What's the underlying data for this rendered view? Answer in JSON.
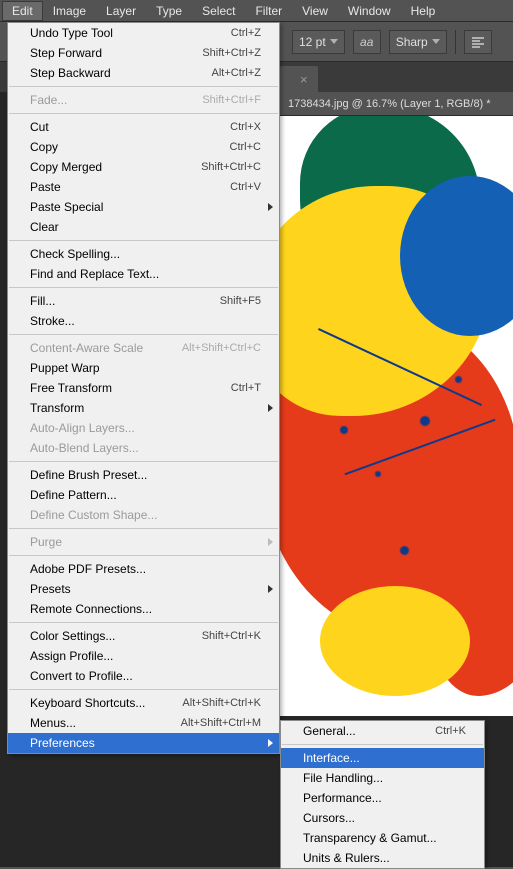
{
  "menubar": {
    "items": [
      "Edit",
      "Image",
      "Layer",
      "Type",
      "Select",
      "Filter",
      "View",
      "Window",
      "Help"
    ],
    "active": 0
  },
  "options": {
    "fontsize": "12 pt",
    "antialias_label": "aa",
    "antialias_mode": "Sharp"
  },
  "tab": {
    "close": "×"
  },
  "document": {
    "title_fragment": "1738434.jpg @ 16.7% (Layer 1, RGB/8) *"
  },
  "edit_menu": [
    {
      "label": "Undo Type Tool",
      "shortcut": "Ctrl+Z"
    },
    {
      "label": "Step Forward",
      "shortcut": "Shift+Ctrl+Z"
    },
    {
      "label": "Step Backward",
      "shortcut": "Alt+Ctrl+Z"
    },
    {
      "sep": true
    },
    {
      "label": "Fade...",
      "shortcut": "Shift+Ctrl+F",
      "disabled": true
    },
    {
      "sep": true
    },
    {
      "label": "Cut",
      "shortcut": "Ctrl+X"
    },
    {
      "label": "Copy",
      "shortcut": "Ctrl+C"
    },
    {
      "label": "Copy Merged",
      "shortcut": "Shift+Ctrl+C"
    },
    {
      "label": "Paste",
      "shortcut": "Ctrl+V"
    },
    {
      "label": "Paste Special",
      "submenu": true
    },
    {
      "label": "Clear"
    },
    {
      "sep": true
    },
    {
      "label": "Check Spelling..."
    },
    {
      "label": "Find and Replace Text..."
    },
    {
      "sep": true
    },
    {
      "label": "Fill...",
      "shortcut": "Shift+F5"
    },
    {
      "label": "Stroke..."
    },
    {
      "sep": true
    },
    {
      "label": "Content-Aware Scale",
      "shortcut": "Alt+Shift+Ctrl+C",
      "disabled": true
    },
    {
      "label": "Puppet Warp"
    },
    {
      "label": "Free Transform",
      "shortcut": "Ctrl+T"
    },
    {
      "label": "Transform",
      "submenu": true
    },
    {
      "label": "Auto-Align Layers...",
      "disabled": true
    },
    {
      "label": "Auto-Blend Layers...",
      "disabled": true
    },
    {
      "sep": true
    },
    {
      "label": "Define Brush Preset..."
    },
    {
      "label": "Define Pattern..."
    },
    {
      "label": "Define Custom Shape...",
      "disabled": true
    },
    {
      "sep": true
    },
    {
      "label": "Purge",
      "submenu": true,
      "disabled": true
    },
    {
      "sep": true
    },
    {
      "label": "Adobe PDF Presets..."
    },
    {
      "label": "Presets",
      "submenu": true
    },
    {
      "label": "Remote Connections..."
    },
    {
      "sep": true
    },
    {
      "label": "Color Settings...",
      "shortcut": "Shift+Ctrl+K"
    },
    {
      "label": "Assign Profile..."
    },
    {
      "label": "Convert to Profile..."
    },
    {
      "sep": true
    },
    {
      "label": "Keyboard Shortcuts...",
      "shortcut": "Alt+Shift+Ctrl+K"
    },
    {
      "label": "Menus...",
      "shortcut": "Alt+Shift+Ctrl+M"
    },
    {
      "label": "Preferences",
      "submenu": true,
      "highlight": true
    }
  ],
  "prefs_submenu": [
    {
      "label": "General...",
      "shortcut": "Ctrl+K"
    },
    {
      "sep": true
    },
    {
      "label": "Interface...",
      "highlight": true
    },
    {
      "label": "File Handling..."
    },
    {
      "label": "Performance..."
    },
    {
      "label": "Cursors..."
    },
    {
      "label": "Transparency & Gamut..."
    },
    {
      "label": "Units & Rulers..."
    }
  ]
}
